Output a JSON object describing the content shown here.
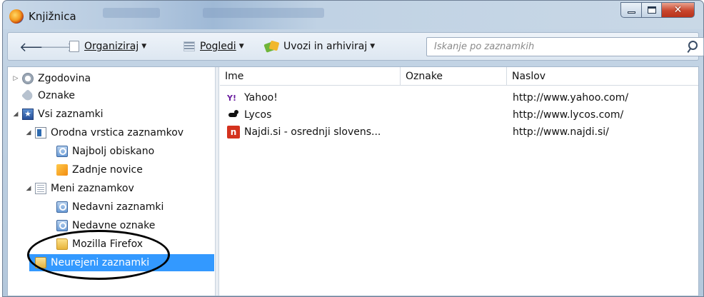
{
  "window": {
    "title": "Knjižnica"
  },
  "toolbar": {
    "organize_label": "Organiziraj",
    "views_label": "Pogledi",
    "import_label": "Uvozi in arhiviraj",
    "search_placeholder": "Iskanje po zaznamkih"
  },
  "sidebar": {
    "items": [
      {
        "label": "Zgodovina",
        "icon": "history-clock-icon"
      },
      {
        "label": "Oznake",
        "icon": "tag-icon"
      },
      {
        "label": "Vsi zaznamki",
        "icon": "bookmarks-star-icon"
      },
      {
        "label": "Orodna vrstica zaznamkov",
        "icon": "bookmarks-toolbar-icon"
      },
      {
        "label": "Najbolj obiskano",
        "icon": "smart-folder-icon"
      },
      {
        "label": "Zadnje novice",
        "icon": "rss-feed-icon"
      },
      {
        "label": "Meni zaznamkov",
        "icon": "bookmarks-menu-icon"
      },
      {
        "label": "Nedavni zaznamki",
        "icon": "smart-folder-icon"
      },
      {
        "label": "Nedavne oznake",
        "icon": "smart-folder-icon"
      },
      {
        "label": "Mozilla Firefox",
        "icon": "folder-icon"
      },
      {
        "label": "Neurejeni zaznamki",
        "icon": "unsorted-bookmarks-icon"
      }
    ]
  },
  "list": {
    "columns": [
      "Ime",
      "Oznake",
      "Naslov"
    ],
    "rows": [
      {
        "name": "Yahoo!",
        "tags": "",
        "url": "http://www.yahoo.com/",
        "icon": "yahoo-favicon"
      },
      {
        "name": "Lycos",
        "tags": "",
        "url": "http://www.lycos.com/",
        "icon": "lycos-favicon"
      },
      {
        "name": "Najdi.si - osrednji slovens...",
        "tags": "",
        "url": "http://www.najdi.si/",
        "icon": "najdi-favicon"
      }
    ]
  },
  "colors": {
    "selection": "#3399ff",
    "chrome": "#c6d6e6"
  }
}
